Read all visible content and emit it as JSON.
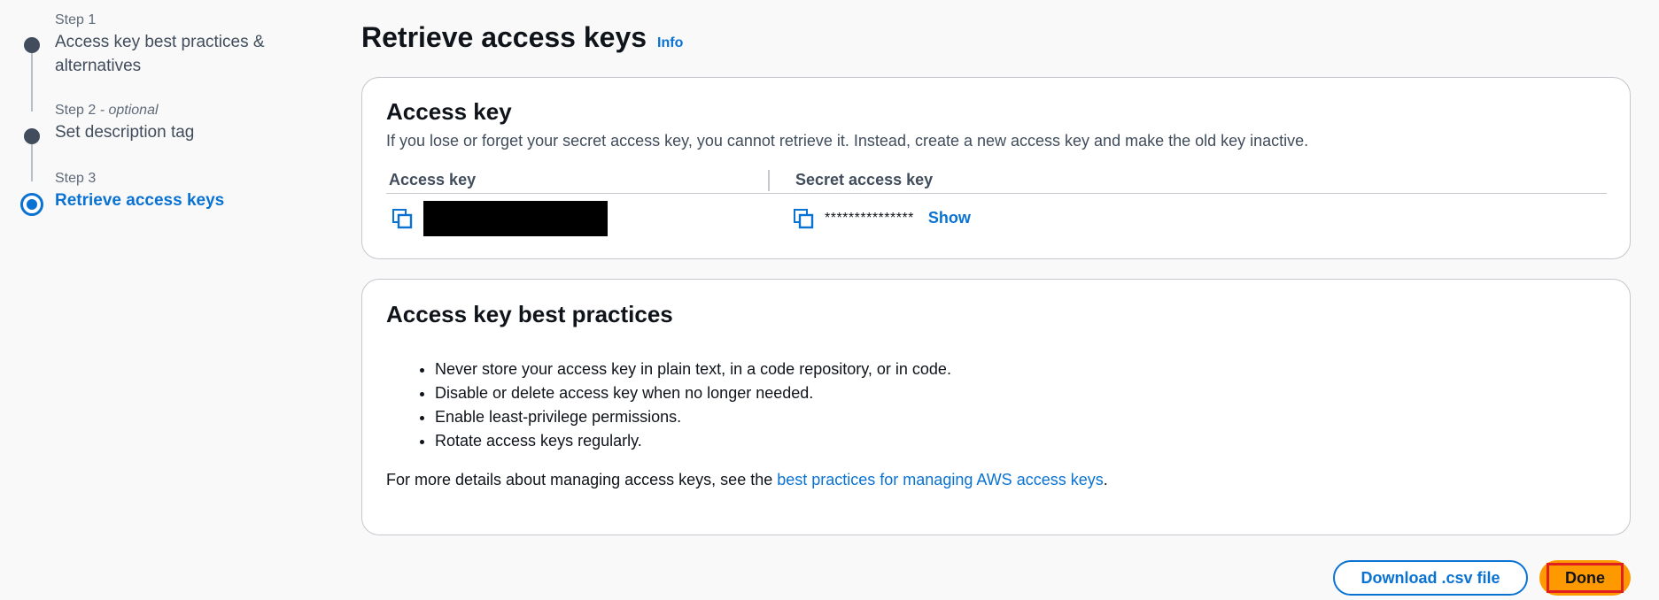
{
  "wizard": {
    "steps": [
      {
        "number": "Step 1",
        "optional": "",
        "title": "Access key best practices & alternatives"
      },
      {
        "number": "Step 2",
        "optional": " - optional",
        "title": "Set description tag"
      },
      {
        "number": "Step 3",
        "optional": "",
        "title": "Retrieve access keys"
      }
    ]
  },
  "page": {
    "title": "Retrieve access keys",
    "info_label": "Info"
  },
  "access_key_card": {
    "heading": "Access key",
    "description": "If you lose or forget your secret access key, you cannot retrieve it. Instead, create a new access key and make the old key inactive.",
    "columns": [
      "Access key",
      "Secret access key"
    ],
    "secret_mask": "***************",
    "show_label": "Show"
  },
  "best_practices_card": {
    "heading": "Access key best practices",
    "items": [
      "Never store your access key in plain text, in a code repository, or in code.",
      "Disable or delete access key when no longer needed.",
      "Enable least-privilege permissions.",
      "Rotate access keys regularly."
    ],
    "footer_prefix": "For more details about managing access keys, see the ",
    "footer_link": "best practices for managing AWS access keys",
    "footer_suffix": "."
  },
  "actions": {
    "download_label": "Download .csv file",
    "done_label": "Done"
  },
  "colors": {
    "accent": "#0972d3",
    "primary_button": "#ff9900",
    "highlight_border": "#e02020"
  }
}
